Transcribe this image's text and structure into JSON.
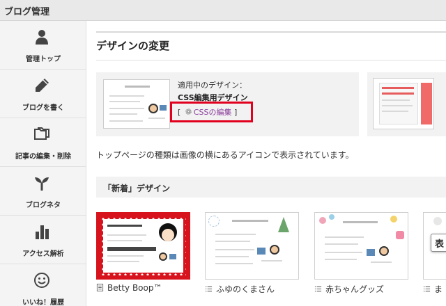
{
  "header": {
    "title": "ブログ管理"
  },
  "sidebar": {
    "items": [
      {
        "label": "管理トップ",
        "icon": "person-icon"
      },
      {
        "label": "ブログを書く",
        "icon": "pencil-icon"
      },
      {
        "label": "記事の編集・削除",
        "icon": "folders-icon"
      },
      {
        "label": "ブログネタ",
        "icon": "sprout-icon"
      },
      {
        "label": "アクセス解析",
        "icon": "bar-chart-icon"
      },
      {
        "label": "いいね！履歴",
        "icon": "smiley-icon"
      }
    ]
  },
  "main": {
    "title": "デザインの変更",
    "current": {
      "caption": "適用中のデザイン：",
      "name": "CSS編集用デザイン",
      "link_open": "[",
      "link_label": "CSSの編集",
      "link_close": "]"
    },
    "description": "トップページの種類は画像の横にあるアイコンで表示されています。",
    "section": {
      "title": "「新着」デザイン"
    },
    "designs": [
      {
        "label": "Betty Boop™"
      },
      {
        "label": "ふゆのくまさん"
      },
      {
        "label": "赤ちゃんグッズ"
      },
      {
        "label": "ま"
      }
    ],
    "card_badge": "表"
  },
  "colors": {
    "highlight": "#e1001e",
    "link": "#8b3d9b",
    "sidebar_bg": "#f4f4f4",
    "panel_bg": "#f2f2f2"
  }
}
